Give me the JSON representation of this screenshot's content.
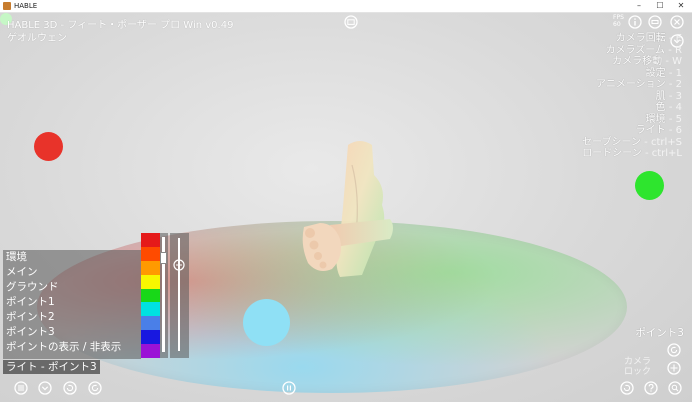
{
  "window": {
    "title": "HABLE",
    "controls": [
      "–",
      "☐",
      "✕"
    ]
  },
  "header": {
    "title": "HABLE 3D - フィート・ポーザー プロ",
    "version": "Win v0.49",
    "author": "ゲオルウェン"
  },
  "fps": {
    "label": "FPS",
    "value": "60"
  },
  "right_menu": [
    {
      "label": "カメラ回転",
      "key": "- E"
    },
    {
      "label": "カメラズーム",
      "key": "- R"
    },
    {
      "label": "カメラ移動",
      "key": "- W"
    },
    {
      "label": "設定",
      "key": "- 1"
    },
    {
      "label": "アニメーション",
      "key": "- 2"
    },
    {
      "label": "肌",
      "key": "- 3"
    },
    {
      "label": "色",
      "key": "- 4"
    },
    {
      "label": "環境",
      "key": "- 5"
    },
    {
      "label": "ライト",
      "key": "- 6"
    },
    {
      "label": "セーブシーン",
      "key": "- ctrl+S"
    },
    {
      "label": "ロードシーン",
      "key": "- ctrl+L"
    }
  ],
  "light_panel": {
    "items": [
      "環境",
      "メイン",
      "グラウンド",
      "ポイント1",
      "ポイント2",
      "ポイント3",
      "ポイントの表示 / 非表示"
    ],
    "palette": [
      "#e51a1a",
      "#ff4b00",
      "#ff9a00",
      "#f7f700",
      "#18d818",
      "#00e1e1",
      "#4a7fe8",
      "#1818e0",
      "#9b12d6"
    ],
    "slider_a_level": 0.15,
    "slider_b_level": 0.2
  },
  "status_label": "ライト - ポイント3",
  "point_label": "ポイント3",
  "camera_label": [
    "カメラ",
    "ロック"
  ],
  "colors": {
    "light_red": "#e8332a",
    "light_green": "#2ee52e",
    "light_cyan": "#8fe0f5",
    "window_bg": "#dcdcdc"
  },
  "icons": {
    "top_right": [
      "info-icon",
      "minimize-panel-icon",
      "close-circle-icon",
      "chevron-down-icon"
    ],
    "bottom_left": [
      "menu-icon",
      "chevron-down-icon",
      "rotate-left-icon",
      "rotate-right-icon"
    ],
    "bottom_center": "pause-icon",
    "bottom_right": [
      "reset-icon",
      "help-icon",
      "zoom-icon"
    ],
    "right_side": [
      "refresh-icon",
      "move-icon"
    ],
    "top_center": "screenshot-icon"
  }
}
